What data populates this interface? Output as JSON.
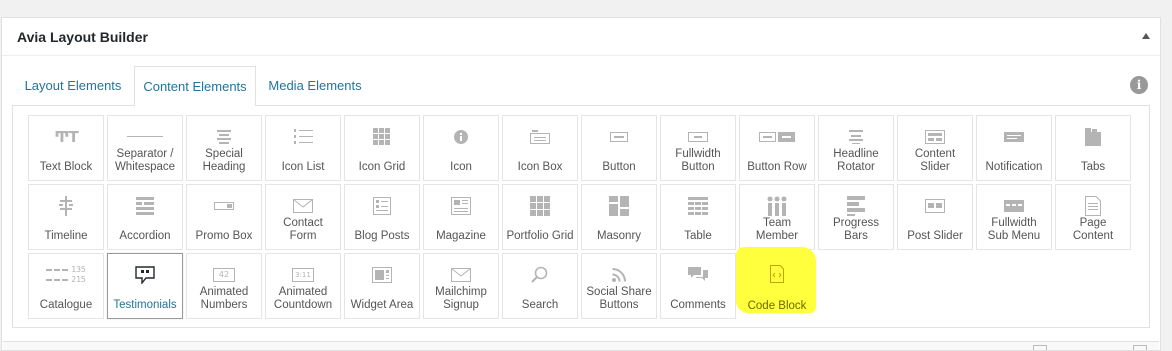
{
  "panel": {
    "title": "Avia Layout Builder"
  },
  "tabs": [
    {
      "label": "Layout Elements",
      "active": false
    },
    {
      "label": "Content Elements",
      "active": true
    },
    {
      "label": "Media Elements",
      "active": false
    }
  ],
  "elements": [
    {
      "label": "Text Block",
      "icon": "text-block-icon"
    },
    {
      "label": "Separator /\nWhitespace",
      "icon": "separator-icon"
    },
    {
      "label": "Special\nHeading",
      "icon": "special-heading-icon"
    },
    {
      "label": "Icon List",
      "icon": "icon-list-icon"
    },
    {
      "label": "Icon Grid",
      "icon": "icon-grid-icon"
    },
    {
      "label": "Icon",
      "icon": "info-circle-icon"
    },
    {
      "label": "Icon Box",
      "icon": "icon-box-icon"
    },
    {
      "label": "Button",
      "icon": "button-icon"
    },
    {
      "label": "Fullwidth\nButton",
      "icon": "fullwidth-button-icon"
    },
    {
      "label": "Button Row",
      "icon": "button-row-icon"
    },
    {
      "label": "Headline\nRotator",
      "icon": "headline-rotator-icon"
    },
    {
      "label": "Content\nSlider",
      "icon": "content-slider-icon"
    },
    {
      "label": "Notification",
      "icon": "notification-icon"
    },
    {
      "label": "Tabs",
      "icon": "tabs-icon"
    },
    {
      "label": "Timeline",
      "icon": "timeline-icon"
    },
    {
      "label": "Accordion",
      "icon": "accordion-icon"
    },
    {
      "label": "Promo Box",
      "icon": "promo-box-icon"
    },
    {
      "label": "Contact\nForm",
      "icon": "envelope-icon"
    },
    {
      "label": "Blog Posts",
      "icon": "blog-posts-icon"
    },
    {
      "label": "Magazine",
      "icon": "magazine-icon"
    },
    {
      "label": "Portfolio Grid",
      "icon": "portfolio-grid-icon"
    },
    {
      "label": "Masonry",
      "icon": "masonry-icon"
    },
    {
      "label": "Table",
      "icon": "table-icon"
    },
    {
      "label": "Team\nMember",
      "icon": "team-member-icon"
    },
    {
      "label": "Progress\nBars",
      "icon": "progress-bars-icon"
    },
    {
      "label": "Post Slider",
      "icon": "post-slider-icon"
    },
    {
      "label": "Fullwidth\nSub Menu",
      "icon": "sub-menu-icon"
    },
    {
      "label": "Page\nContent",
      "icon": "page-content-icon"
    },
    {
      "label": "Catalogue",
      "icon": "catalogue-icon",
      "icon_text": [
        "135",
        "215"
      ]
    },
    {
      "label": "Testimonials",
      "icon": "speech-bubble-icon",
      "selected": true
    },
    {
      "label": "Animated\nNumbers",
      "icon": "animated-numbers-icon",
      "icon_text": [
        "42"
      ]
    },
    {
      "label": "Animated\nCountdown",
      "icon": "countdown-icon",
      "icon_text": [
        "3:11"
      ]
    },
    {
      "label": "Widget Area",
      "icon": "widget-area-icon"
    },
    {
      "label": "Mailchimp\nSignup",
      "icon": "envelope-icon"
    },
    {
      "label": "Search",
      "icon": "search-icon"
    },
    {
      "label": "Social Share\nButtons",
      "icon": "share-icon"
    },
    {
      "label": "Comments",
      "icon": "comments-icon"
    },
    {
      "label": "Code Block",
      "icon": "code-block-icon",
      "highlighted": true
    }
  ],
  "colors": {
    "link": "#21759b",
    "highlight": "#ffff3d",
    "icon": "#b4b4b4",
    "label": "#555555"
  }
}
